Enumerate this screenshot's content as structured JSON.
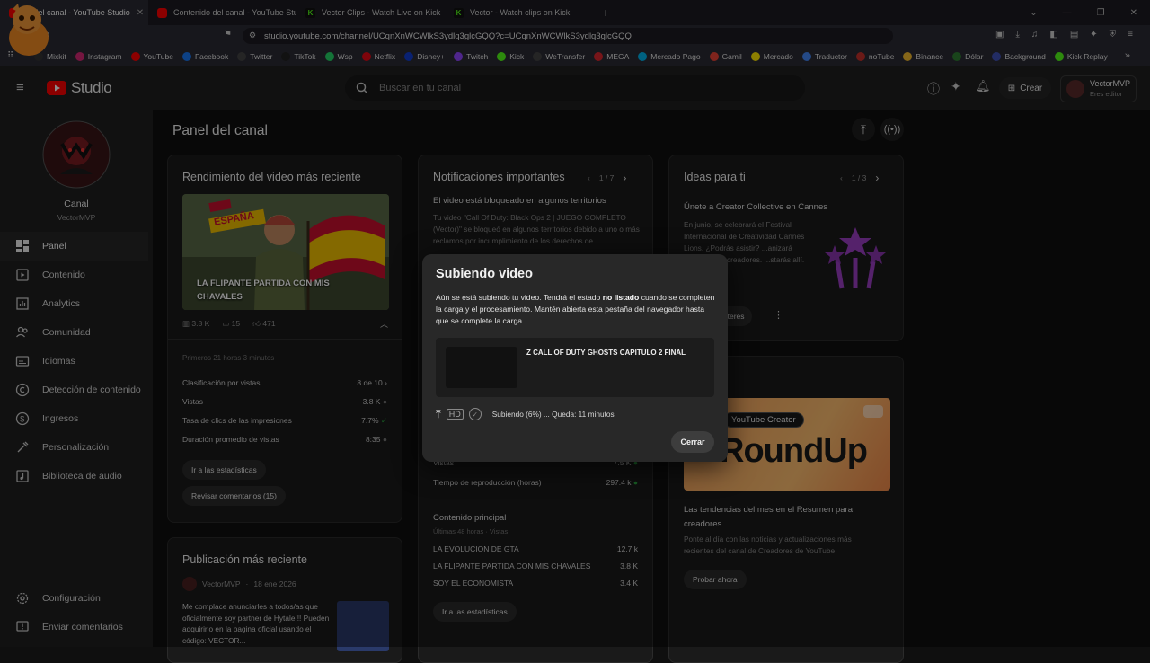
{
  "browser": {
    "tabs": [
      {
        "label": "el del canal - YouTube Studio",
        "icon": "youtube",
        "active": true
      },
      {
        "label": "Contenido del canal - YouTube Studio",
        "icon": "youtube"
      },
      {
        "label": "Vector Clips - Watch Live on Kick",
        "icon": "kick"
      },
      {
        "label": "Vector - Watch clips on Kick",
        "icon": "kick"
      }
    ],
    "url": "studio.youtube.com/channel/UCqnXnWCWlkS3ydlq3glcGQQ?c=UCqnXnWCWlkS3ydlq3glcGQQ",
    "bookmarks": [
      "Mixkit",
      "Instagram",
      "YouTube",
      "Facebook",
      "Twitter",
      "TikTok",
      "Wsp",
      "Netflix",
      "Disney+",
      "Twitch",
      "Kick",
      "WeTransfer",
      "MEGA",
      "Mercado Pago",
      "Gamil",
      "Mercado",
      "Traductor",
      "noTube",
      "Binance",
      "Dólar",
      "Background",
      "Kick Replay"
    ],
    "bookmark_colors": [
      "#333333",
      "#d62976",
      "#ff0000",
      "#1877f2",
      "#444444",
      "#222222",
      "#25d366",
      "#e50914",
      "#113ccf",
      "#9146ff",
      "#53fc18",
      "#444444",
      "#d9272e",
      "#00b1ea",
      "#ea4335",
      "#ffe600",
      "#4285f4",
      "#c4302b",
      "#f3ba2f",
      "#2e7d32",
      "#3f51b5",
      "#53fc18"
    ]
  },
  "header": {
    "logo_text": "Studio",
    "search_placeholder": "Buscar en tu canal",
    "create_label": "Crear",
    "account_name": "VectorMVP",
    "account_role": "Eres editor"
  },
  "sidebar": {
    "channel_label": "Canal",
    "channel_name": "VectorMVP",
    "items": [
      {
        "label": "Panel",
        "icon": "dashboard-icon",
        "active": true
      },
      {
        "label": "Contenido",
        "icon": "content-icon"
      },
      {
        "label": "Analytics",
        "icon": "analytics-icon"
      },
      {
        "label": "Comunidad",
        "icon": "community-icon"
      },
      {
        "label": "Idiomas",
        "icon": "subtitles-icon"
      },
      {
        "label": "Detección de contenido",
        "icon": "copyright-icon"
      },
      {
        "label": "Ingresos",
        "icon": "earn-icon"
      },
      {
        "label": "Personalización",
        "icon": "customization-icon"
      },
      {
        "label": "Biblioteca de audio",
        "icon": "audio-library-icon"
      }
    ],
    "settings_label": "Configuración",
    "feedback_label": "Enviar comentarios"
  },
  "main": {
    "page_title": "Panel del canal",
    "latest_video": {
      "title": "Rendimiento del video más reciente",
      "thumb_title": "LA FLIPANTE PARTIDA CON MIS CHAVALES",
      "thumb_tag": "ESPAÑA",
      "views": "3.8 K",
      "comments": "15",
      "likes": "471",
      "period": "Primeros 21 horas 3 minutos",
      "stats": [
        {
          "label": "Clasificación por vistas",
          "value": "8 de 10"
        },
        {
          "label": "Vistas",
          "value": "3.8 K"
        },
        {
          "label": "Tasa de clics de las impresiones",
          "value": "7.7%"
        },
        {
          "label": "Duración promedio de vistas",
          "value": "8:35"
        }
      ],
      "btn_stats": "Ir a las estadísticas",
      "btn_comments": "Revisar comentarios (15)"
    },
    "latest_post": {
      "title": "Publicación más reciente",
      "author": "VectorMVP",
      "date": "18 ene 2026",
      "text": "Me complace anunciarles a todos/as que oficialmente soy partner de Hytale!!! Pueden adquirirlo en la pagina oficial usando el código: VECTOR..."
    },
    "notifications": {
      "title": "Notificaciones importantes",
      "pager": "1 / 7",
      "item_title": "El video está bloqueado en algunos territorios",
      "item_text": "Tu video \"Call Of Duty: Black Ops 2 | JUEGO COMPLETO (Vector)\" se bloqueó en algunos territorios debido a uno o más reclamos por incumplimiento de los derechos de...",
      "stat_rows": [
        {
          "label": "Vistas",
          "value": "7.5 K"
        },
        {
          "label": "Tiempo de reproducción (horas)",
          "value": "297.4 k"
        }
      ],
      "top_content_title": "Contenido principal",
      "top_content_sub": "Últimas 48 horas · Vistas",
      "top_content": [
        {
          "label": "LA EVOLUCION DE GTA",
          "value": "12.7 k"
        },
        {
          "label": "LA FLIPANTE PARTIDA CON MIS CHAVALES",
          "value": "3.8 K"
        },
        {
          "label": "SOY EL ECONOMISTA",
          "value": "3.4 K"
        }
      ],
      "btn_stats": "Ir a las estadísticas"
    },
    "ideas": {
      "title": "Ideas para ti",
      "pager": "1 / 3",
      "item_title": "Únete a Creator Collective en Cannes",
      "item_text": "En junio, se celebrará el Festival Internacional de Creatividad Cannes Lions. ¿Podrás asistir? ...anizará eventos ...ra creadores. ...starás allí.",
      "btn_interest": "interés",
      "roundup_badge": "YouTube Creator",
      "roundup_word": "RoundUp",
      "news_title": "Las tendencias del mes en el Resumen para creadores",
      "news_text": "Ponte al día con las noticias y actualizaciones más recientes del canal de Creadores de YouTube",
      "btn_try": "Probar ahora"
    }
  },
  "modal": {
    "title": "Subiendo video",
    "text_before": "Aún se está subiendo tu video. Tendrá el estado",
    "text_bold": "no listado",
    "text_after": "cuando se completen la carga y el procesamiento. Mantén abierta esta pestaña del navegador hasta que se complete la carga.",
    "video_title": "Z CALL OF DUTY GHOSTS CAPITULO 2 FINAL",
    "status": "Subiendo (6%) ... Queda: 11 minutos",
    "progress": 0.06,
    "close_label": "Cerrar"
  }
}
